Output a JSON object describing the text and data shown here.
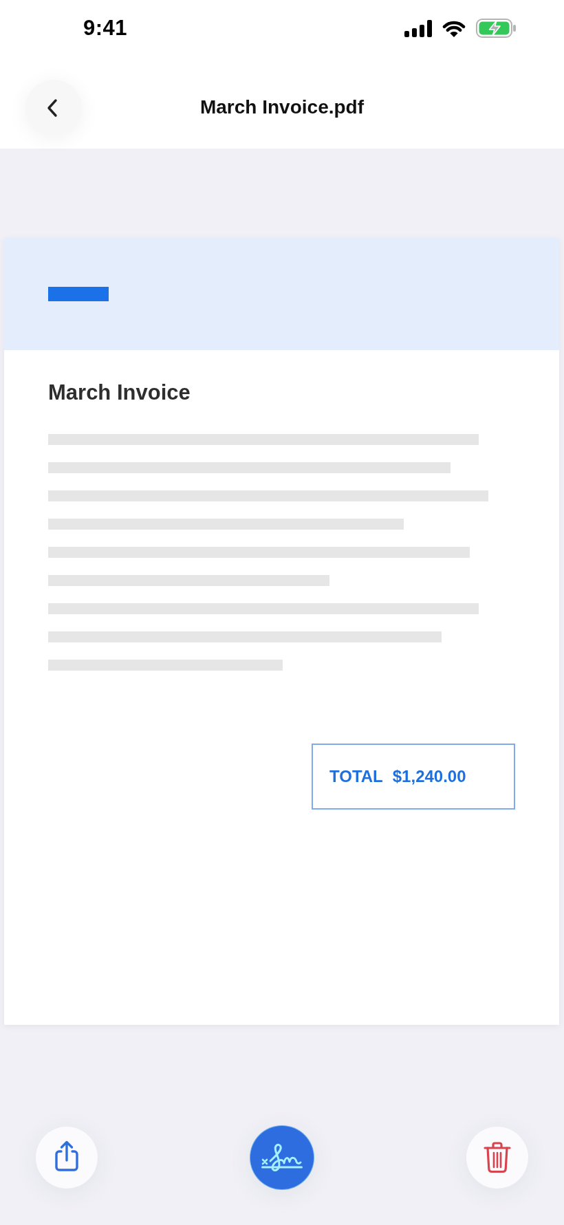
{
  "status_bar": {
    "time": "9:41"
  },
  "nav_bar": {
    "title": "March Invoice.pdf"
  },
  "document": {
    "title": "March Invoice",
    "total": {
      "label": "TOTAL",
      "amount": "$1,240.00"
    }
  },
  "toolbar": {
    "buttons": [
      {
        "kind": "share"
      },
      {
        "kind": "sign"
      },
      {
        "kind": "delete"
      }
    ]
  }
}
